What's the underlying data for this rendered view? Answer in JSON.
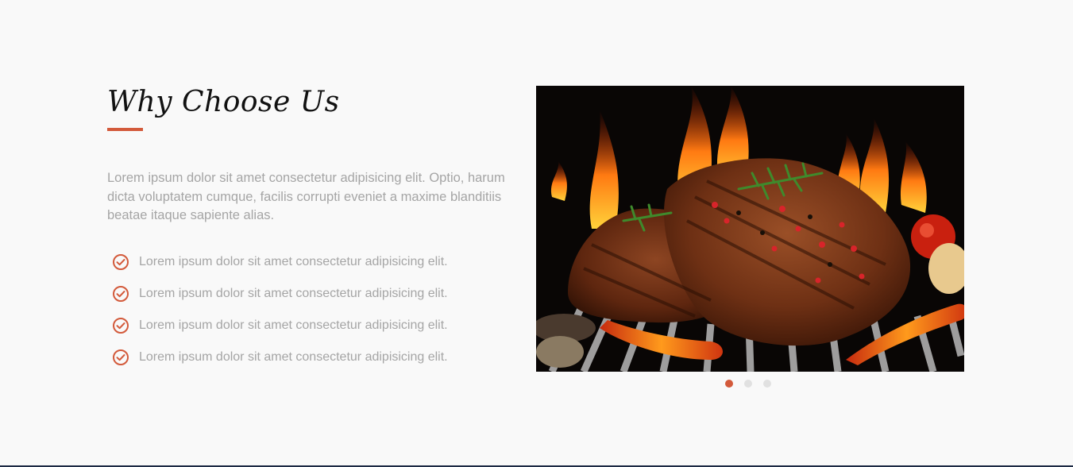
{
  "section": {
    "title": "Why Choose Us",
    "intro": "Lorem ipsum dolor sit amet consectetur adipisicing elit. Optio, harum dicta voluptatem cumque, facilis corrupti eveniet a maxime blanditiis beatae itaque sapiente alias.",
    "features": [
      {
        "icon": "check-circle-icon",
        "text": "Lorem ipsum dolor sit amet consectetur adipisicing elit."
      },
      {
        "icon": "check-circle-icon",
        "text": "Lorem ipsum dolor sit amet consectetur adipisicing elit."
      },
      {
        "icon": "check-circle-icon",
        "text": "Lorem ipsum dolor sit amet consectetur adipisicing elit."
      },
      {
        "icon": "check-circle-icon",
        "text": "Lorem ipsum dolor sit amet consectetur adipisicing elit."
      }
    ]
  },
  "slider": {
    "image": "grilled-steak-on-flaming-grill",
    "slide_count": 3,
    "active_slide": 1
  },
  "colors": {
    "accent": "#d35a3b",
    "text_muted": "#a5a5a5",
    "heading": "#111111",
    "background": "#f9f9f9",
    "dot_inactive": "#e1e1e1"
  }
}
